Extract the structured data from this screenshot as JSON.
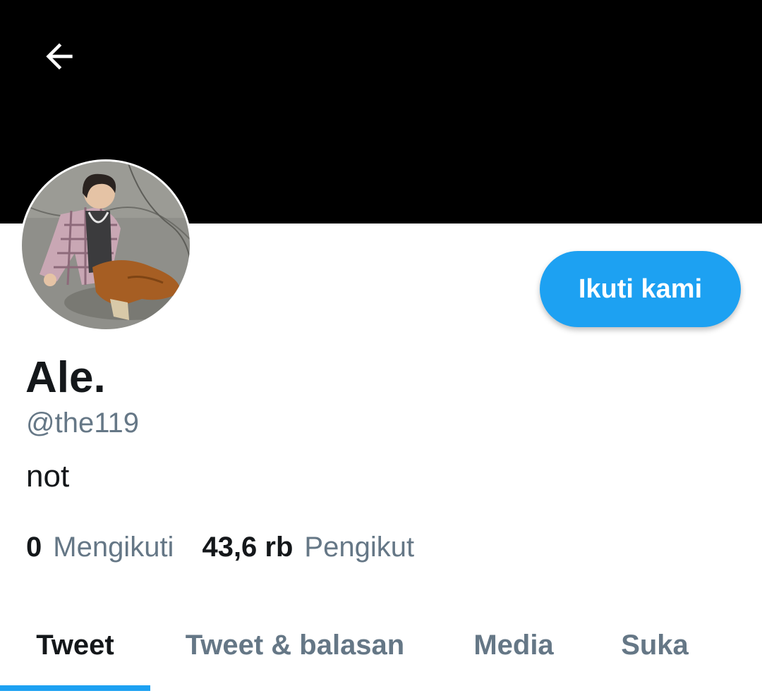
{
  "header": {
    "back_icon": "arrow-left-icon"
  },
  "profile": {
    "avatar_icon": "profile-photo",
    "display_name": "Ale.",
    "handle": "@the119",
    "bio": "not",
    "follow_label": "Ikuti kami"
  },
  "stats": {
    "following_count": "0",
    "following_label": "Mengikuti",
    "followers_count": "43,6 rb",
    "followers_label": "Pengikut"
  },
  "tabs": [
    {
      "label": "Tweet",
      "active": true
    },
    {
      "label": "Tweet & balasan",
      "active": false
    },
    {
      "label": "Media",
      "active": false
    },
    {
      "label": "Suka",
      "active": false
    }
  ],
  "colors": {
    "accent": "#1da1f2",
    "banner": "#000000",
    "secondary_text": "#657786",
    "primary_text": "#14171a"
  }
}
